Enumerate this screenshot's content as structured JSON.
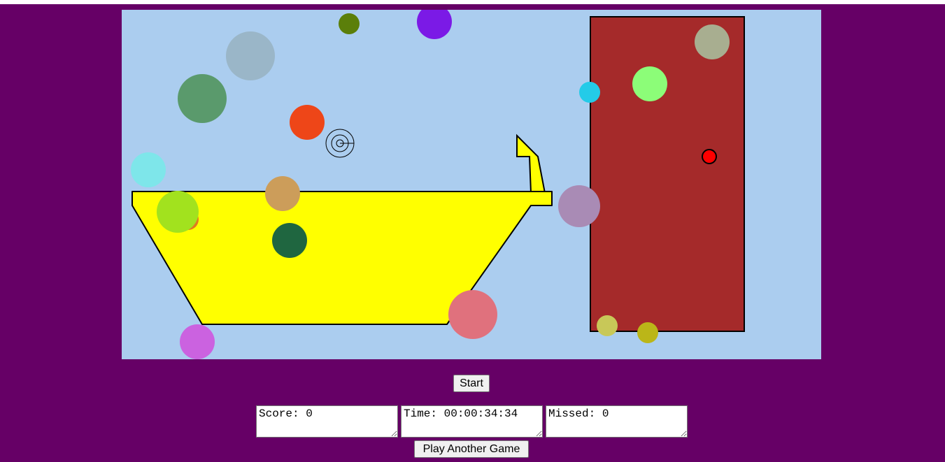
{
  "colors": {
    "page_background": "#660066",
    "sky": "#abcdef",
    "tub": "#ffff00",
    "door": "#a52a2a",
    "target_dot": "#ff0000"
  },
  "controls": {
    "start_label": "Start",
    "play_again_label": "Play Another Game"
  },
  "stats": {
    "score": "Score: 0",
    "time": "Time: 00:00:34:34",
    "missed": "Missed: 0"
  },
  "bubbles": [
    {
      "color": "#5b7f0a"
    },
    {
      "color": "#7b1ae6"
    },
    {
      "color": "#9ab6c8"
    },
    {
      "color": "#5a9a6c"
    },
    {
      "color": "#ee4618"
    },
    {
      "color": "#7ee6ea"
    },
    {
      "color": "#cc9d5a"
    },
    {
      "color": "#e07a20"
    },
    {
      "color": "#a2e21e"
    },
    {
      "color": "#1f6640"
    },
    {
      "color": "#cb62e0"
    },
    {
      "color": "#e0717d"
    },
    {
      "color": "#a98bb5"
    },
    {
      "color": "#24cbe8"
    },
    {
      "color": "#8cfd78"
    },
    {
      "color": "#a8ae90"
    },
    {
      "color": "#c8c858"
    },
    {
      "color": "#bbb618"
    }
  ]
}
